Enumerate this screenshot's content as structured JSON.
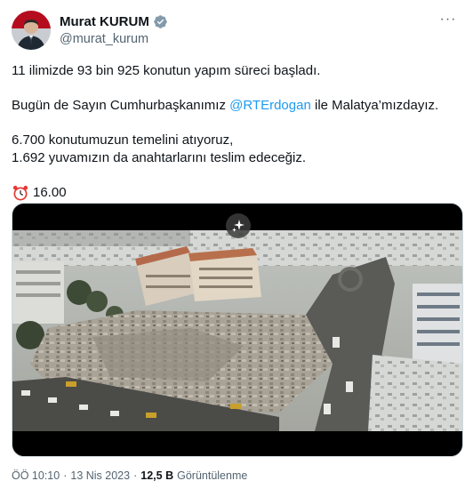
{
  "author": {
    "display_name": "Murat KURUM",
    "handle": "@murat_kurum",
    "verified_icon": "verified-badge-icon",
    "avatar_icon": "profile-photo"
  },
  "more_label": "···",
  "tweet": {
    "line1": "11 ilimizde 93 bin 925 konutun yapım süreci başladı.",
    "line2_before": "Bugün de Sayın Cumhurbaşkanımız ",
    "line2_mention": "@RTErdogan",
    "line2_after": " ile Malatya’mızdayız.",
    "line3": "6.700 konutumuzun temelini atıyoruz,",
    "line4": "1.692 yuvamızın da anahtarlarını teslim edeceğiz.",
    "time_text": "16.00",
    "time_icon": "alarm-clock-icon"
  },
  "media": {
    "type": "video",
    "overlay_icon": "sparkle-icon"
  },
  "footer": {
    "time": "ÖÖ 10:10",
    "separator": "·",
    "date": "13 Nis 2023",
    "views_count": "12,5 B",
    "views_label": "Görüntülenme"
  },
  "colors": {
    "link": "#1d9bf0",
    "muted": "#536471",
    "text": "#0f1419"
  }
}
